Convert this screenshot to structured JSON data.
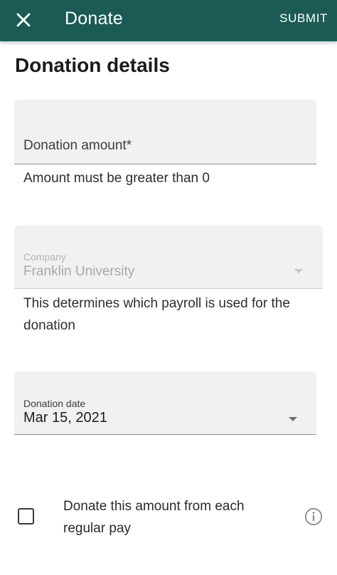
{
  "appbar": {
    "title": "Donate",
    "submit_label": "SUBMIT",
    "close_icon": "close-icon",
    "background_color": "#1c5b55"
  },
  "section": {
    "title": "Donation details"
  },
  "amount_field": {
    "label": "Donation amount*",
    "value": "",
    "helper": "Amount must be greater than 0"
  },
  "company_field": {
    "label": "Company",
    "value": "Franklin University",
    "helper": "This determines which payroll is used for the donation",
    "disabled": true
  },
  "date_field": {
    "label": "Donation date",
    "value": "Mar 15, 2021"
  },
  "recurring": {
    "checked": false,
    "label": "Donate this amount from each regular pay",
    "info_icon": "info-icon"
  }
}
